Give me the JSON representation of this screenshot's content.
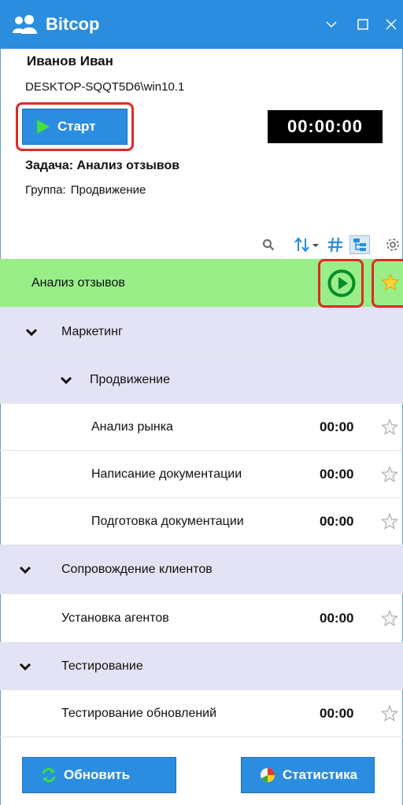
{
  "window": {
    "title": "Bitcop",
    "logo_icon": "users-icon",
    "controls": [
      "minimize-icon",
      "maximize-icon",
      "close-icon"
    ]
  },
  "user": {
    "name": "Иванов Иван",
    "machine": "DESKTOP-SQQT5D6\\win10.1"
  },
  "start_button": {
    "label": "Старт",
    "icon": "play-icon"
  },
  "timer": "00:00:00",
  "task": {
    "label": "Задача:",
    "value": "Анализ отзывов"
  },
  "group": {
    "label": "Группа:",
    "value": "Продвижение"
  },
  "search": {
    "placeholder": "",
    "value": ""
  },
  "toolbar": [
    "search-icon",
    "sort-icon",
    "hash-icon",
    "tree-view-icon",
    "settings-icon"
  ],
  "tree": [
    {
      "type": "active",
      "label": "Анализ отзывов",
      "time": ""
    },
    {
      "type": "group",
      "label": "Маркетинг",
      "time": ""
    },
    {
      "type": "group",
      "label": "Продвижение",
      "time": ""
    },
    {
      "type": "task",
      "label": "Анализ рынка",
      "time": "00:00"
    },
    {
      "type": "task",
      "label": "Написание документации",
      "time": "00:00"
    },
    {
      "type": "task",
      "label": "Подготовка документации",
      "time": "00:00"
    },
    {
      "type": "group",
      "label": "Сопровождение клиентов",
      "time": ""
    },
    {
      "type": "task",
      "label": "Установка агентов",
      "time": "00:00"
    },
    {
      "type": "group",
      "label": "Тестирование",
      "time": ""
    },
    {
      "type": "task",
      "label": "Тестирование обновлений",
      "time": "00:00"
    }
  ],
  "buttons": {
    "refresh": "Обновить",
    "stats": "Статистика"
  },
  "colors": {
    "accent": "#2b8de0",
    "active_row": "#99ee88",
    "group_row": "#e3e3f5",
    "highlight": "#e02828"
  }
}
